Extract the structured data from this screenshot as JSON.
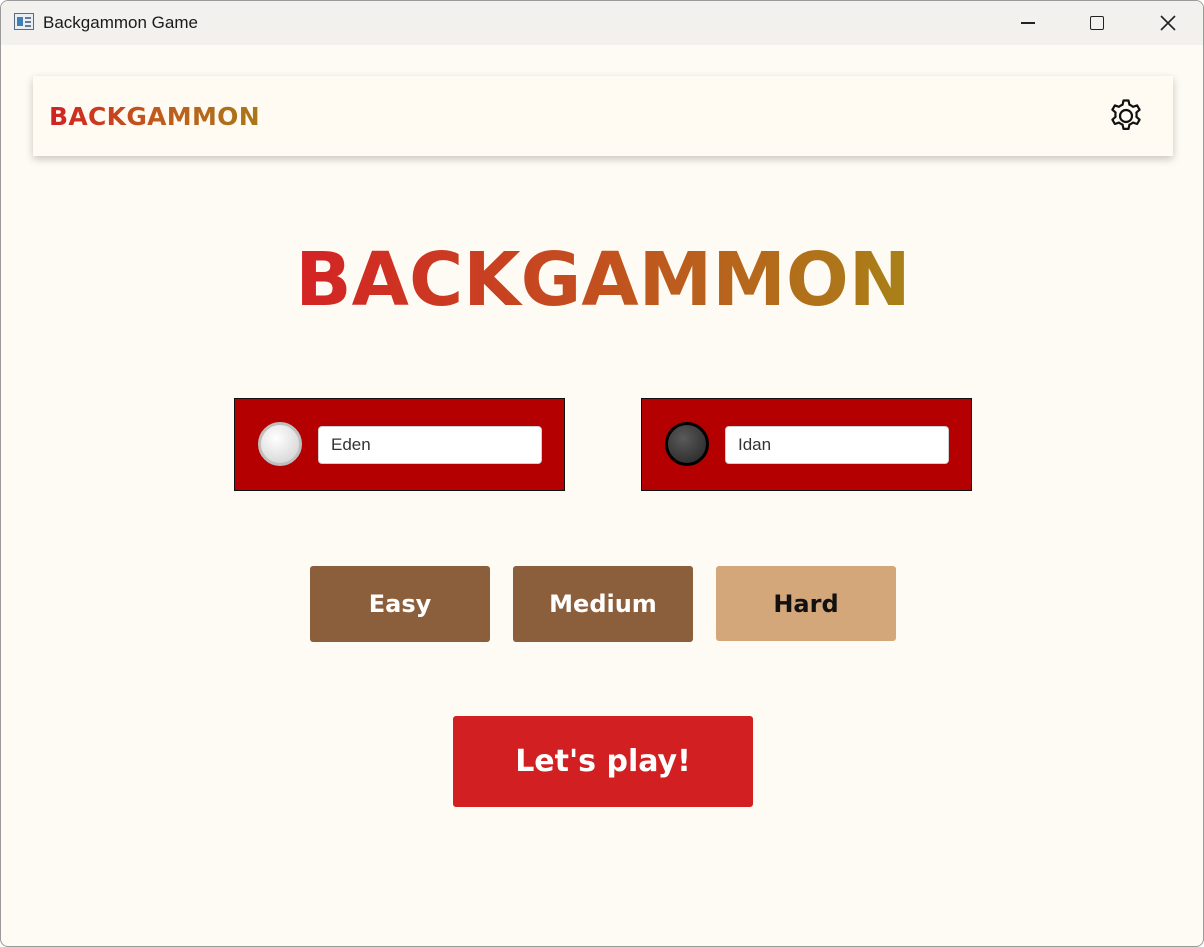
{
  "window": {
    "title": "Backgammon Game"
  },
  "header": {
    "title": "BACKGAMMON",
    "settings_icon": "gear-icon"
  },
  "main": {
    "title": "BACKGAMMON"
  },
  "players": [
    {
      "checker_color": "white",
      "name": "Eden"
    },
    {
      "checker_color": "black",
      "name": "Idan"
    }
  ],
  "difficulty": {
    "options": [
      "Easy",
      "Medium",
      "Hard"
    ],
    "selected": "Hard"
  },
  "play_button": {
    "label": "Let's play!"
  },
  "colors": {
    "background": "#fefbf4",
    "player_card": "#b40000",
    "difficulty_default": "#8b5e3c",
    "difficulty_selected": "#d3a77a",
    "play_button": "#d21f22",
    "title_gradient_start": "#d42324",
    "title_gradient_end": "#a88118"
  }
}
